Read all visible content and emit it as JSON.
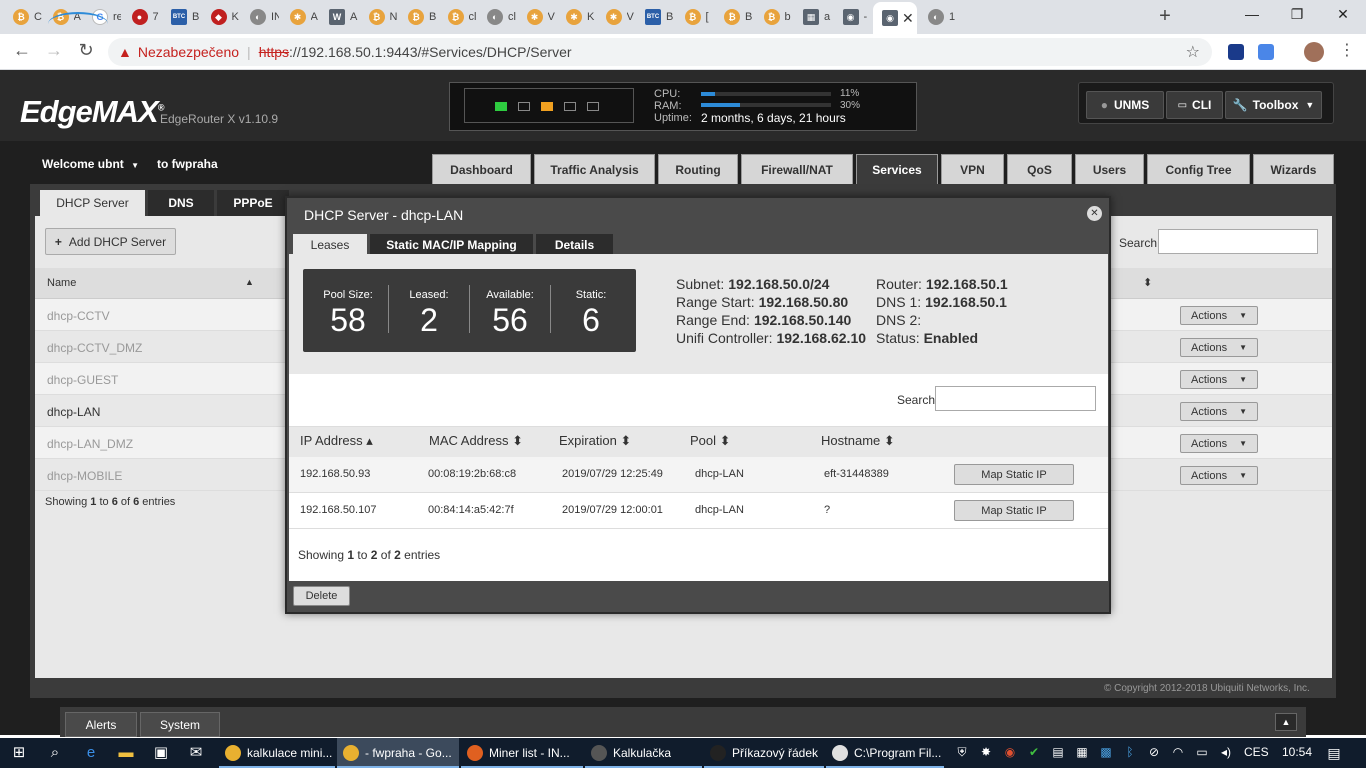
{
  "browser": {
    "tabs": [
      {
        "icon": "bitcoin-icon",
        "title": "C"
      },
      {
        "icon": "bitcoin-icon",
        "title": "A"
      },
      {
        "icon": "google-icon",
        "title": "re"
      },
      {
        "icon": "red-circle-icon",
        "title": "7"
      },
      {
        "icon": "btc-square-icon",
        "title": "Bi"
      },
      {
        "icon": "cat-icon",
        "title": "K"
      },
      {
        "icon": "globe-icon",
        "title": "IN"
      },
      {
        "icon": "gear-icon",
        "title": "A"
      },
      {
        "icon": "wtm-icon",
        "title": "A"
      },
      {
        "icon": "bitcoin-icon",
        "title": "N"
      },
      {
        "icon": "bitcoin-icon",
        "title": "B"
      },
      {
        "icon": "bitcoin-icon",
        "title": "cl"
      },
      {
        "icon": "globe-icon",
        "title": "cl"
      },
      {
        "icon": "gear-icon",
        "title": "V"
      },
      {
        "icon": "gear-icon",
        "title": "K"
      },
      {
        "icon": "gear-icon",
        "title": "V"
      },
      {
        "icon": "btc-square-icon",
        "title": "B"
      },
      {
        "icon": "bitcoin-icon",
        "title": "["
      },
      {
        "icon": "bitcoin-icon",
        "title": "B"
      },
      {
        "icon": "bitcoin-icon",
        "title": "b"
      },
      {
        "icon": "image-icon",
        "title": "a"
      },
      {
        "icon": "edgemax-icon",
        "title": "-"
      },
      {
        "icon": "edgemax-icon",
        "title": "",
        "active": true
      },
      {
        "icon": "globe-icon",
        "title": "1"
      }
    ],
    "active_close": "✕",
    "newtab": "+",
    "insecure_label": "Nezabezpečeno",
    "url_scheme": "https",
    "url_rest": "://192.168.50.1:9443/#Services/DHCP/Server"
  },
  "header": {
    "logo": "EdgeMAX",
    "router_version": "EdgeRouter X v1.10.9",
    "cpu_label": "CPU:",
    "cpu_pct": "11%",
    "cpu_value": 11,
    "ram_label": "RAM:",
    "ram_pct": "30%",
    "ram_value": 30,
    "uptime_label": "Uptime:",
    "uptime_value": "2 months, 6 days, 21 hours",
    "unms_label": "UNMS",
    "cli_label": "CLI",
    "toolbox_label": "Toolbox"
  },
  "nav": {
    "welcome": "Welcome ubnt",
    "context": "to fwpraha",
    "tabs": [
      "Dashboard",
      "Traffic Analysis",
      "Routing",
      "Firewall/NAT",
      "Services",
      "VPN",
      "QoS",
      "Users",
      "Config Tree",
      "Wizards"
    ],
    "active": "Services"
  },
  "services": {
    "subtabs": [
      "DHCP Server",
      "DNS",
      "PPPoE"
    ],
    "add_button": "Add DHCP Server",
    "search_label": "Search",
    "col_name": "Name",
    "servers": [
      {
        "name": "dhcp-CCTV",
        "enabled": false
      },
      {
        "name": "dhcp-CCTV_DMZ",
        "enabled": false
      },
      {
        "name": "dhcp-GUEST",
        "enabled": false
      },
      {
        "name": "dhcp-LAN",
        "enabled": true
      },
      {
        "name": "dhcp-LAN_DMZ",
        "enabled": false
      },
      {
        "name": "dhcp-MOBILE",
        "enabled": false
      }
    ],
    "actions_label": "Actions",
    "showing": {
      "prefix": "Showing ",
      "from": "1",
      "to_text": " to ",
      "to": "6",
      "of_text": " of ",
      "total": "6",
      "suffix": " entries"
    },
    "copyright": "© Copyright 2012-2018 Ubiquiti Networks, Inc."
  },
  "dialog": {
    "title": "DHCP Server - dhcp-LAN",
    "tabs": [
      "Leases",
      "Static MAC/IP Mapping",
      "Details"
    ],
    "pool": [
      {
        "label": "Pool Size:",
        "value": "58"
      },
      {
        "label": "Leased:",
        "value": "2"
      },
      {
        "label": "Available:",
        "value": "56"
      },
      {
        "label": "Static:",
        "value": "6"
      }
    ],
    "info_left": [
      {
        "label": "Subnet:",
        "value": "192.168.50.0/24"
      },
      {
        "label": "Range Start:",
        "value": "192.168.50.80"
      },
      {
        "label": "Range End:",
        "value": "192.168.50.140"
      },
      {
        "label": "Unifi Controller:",
        "value": "192.168.62.10"
      }
    ],
    "info_right": [
      {
        "label": "Router:",
        "value": "192.168.50.1"
      },
      {
        "label": "DNS 1:",
        "value": "192.168.50.1"
      },
      {
        "label": "DNS 2:",
        "value": ""
      },
      {
        "label": "Status:",
        "value": "Enabled"
      }
    ],
    "search_label": "Search",
    "columns": [
      "IP Address ▴",
      "MAC Address ⬍",
      "Expiration ⬍",
      "Pool ⬍",
      "Hostname ⬍"
    ],
    "leases": [
      {
        "ip": "192.168.50.93",
        "mac": "00:08:19:2b:68:c8",
        "expiration": "2019/07/29 12:25:49",
        "pool": "dhcp-LAN",
        "hostname": "eft-31448389"
      },
      {
        "ip": "192.168.50.107",
        "mac": "00:84:14:a5:42:7f",
        "expiration": "2019/07/29 12:00:01",
        "pool": "dhcp-LAN",
        "hostname": "?"
      }
    ],
    "map_button": "Map Static IP",
    "showing": {
      "prefix": "Showing ",
      "from": "1",
      "to_text": " to ",
      "to": "2",
      "of_text": " of ",
      "total": "2",
      "suffix": " entries"
    },
    "delete_label": "Delete"
  },
  "footer_bar": {
    "alerts": "Alerts",
    "system": "System"
  },
  "taskbar": {
    "apps": [
      {
        "title": "kalkulace mini...",
        "icon": "chrome-icon",
        "active": false
      },
      {
        "title": "- fwpraha - Go...",
        "icon": "chrome-icon",
        "active": true
      },
      {
        "title": "Miner list - IN...",
        "icon": "firefox-icon",
        "active": false
      },
      {
        "title": "Kalkulačka",
        "icon": "calculator-icon",
        "active": false
      },
      {
        "title": "Příkazový řádek",
        "icon": "cmd-icon",
        "active": false
      },
      {
        "title": "C:\\Program Fil...",
        "icon": "program-icon",
        "active": false
      }
    ],
    "lang": "CES",
    "time": "10:54"
  },
  "colors": {
    "accent_blue": "#2d8bd8",
    "port_green": "#2ecc40",
    "port_orange": "#f0a020",
    "insecure_red": "#c5221f"
  }
}
